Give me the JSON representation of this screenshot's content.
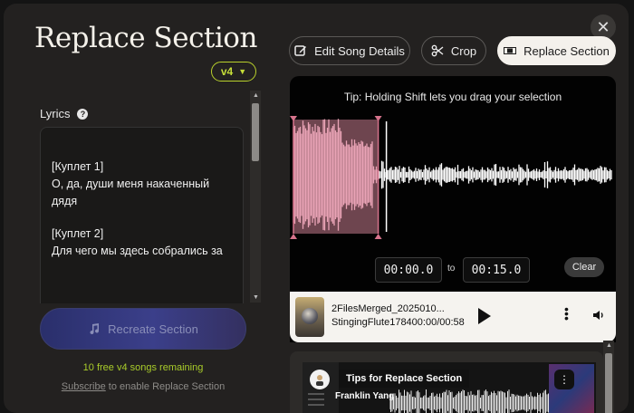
{
  "dialog": {
    "title": "Replace Section",
    "close_glyph": "✕",
    "version_label": "v4"
  },
  "lyrics": {
    "label": "Lyrics",
    "help_glyph": "?",
    "lines": [
      "[Куплет 1]",
      "О, да, души меня накаченный дядя",
      "",
      "[Куплет 2]",
      "Для чего мы здесь собрались за"
    ]
  },
  "actions": {
    "recreate_label": "Recreate Section",
    "free_note": "10 free v4 songs remaining",
    "subscribe_link": "Subscribe",
    "subscribe_rest": " to enable Replace Section"
  },
  "toolbar": {
    "edit_label": "Edit Song Details",
    "crop_label": "Crop",
    "replace_label": "Replace Section"
  },
  "editor": {
    "tip": "Tip: Holding Shift lets you drag your selection",
    "selection_start_fraction": 0.0,
    "selection_end_fraction": 0.26,
    "playhead_fraction": 0.285,
    "start_time": "00:00.0",
    "to_label": "to",
    "end_time": "00:15.0",
    "clear_label": "Clear",
    "selection_color": "#e9a3b6",
    "waveform_color": "#ffffff"
  },
  "player": {
    "song_title": "2FilesMerged_2025010...",
    "song_subtitle": "StingingFlute178400:00/00:58"
  },
  "tips": {
    "heading": "Tips for Replace Section",
    "user_name": "Franklin Yang"
  }
}
